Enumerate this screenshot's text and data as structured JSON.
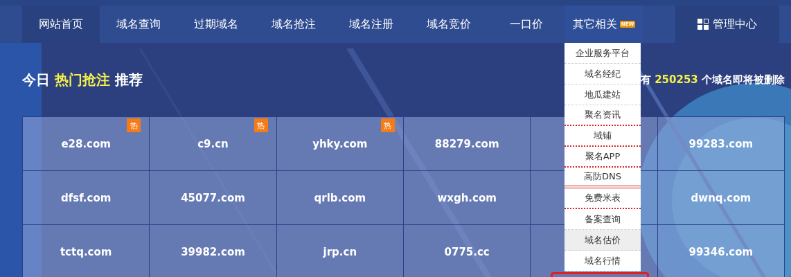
{
  "nav": {
    "items": [
      {
        "label": "网站首页",
        "selected": true
      },
      {
        "label": "域名查询",
        "selected": false
      },
      {
        "label": "过期域名",
        "selected": false
      },
      {
        "label": "域名抢注",
        "selected": false
      },
      {
        "label": "域名注册",
        "selected": false
      },
      {
        "label": "域名竞价",
        "selected": false
      },
      {
        "label": "一口价",
        "selected": false
      },
      {
        "label": "其它相关",
        "selected": false,
        "badge": "NEW",
        "expanded": true
      }
    ],
    "admin": "管理中心"
  },
  "heading": [
    {
      "text": "今日 ",
      "highlight": false
    },
    {
      "text": "热门抢注",
      "highlight": true
    },
    {
      "text": " 推荐",
      "highlight": false
    }
  ],
  "notice": [
    {
      "text": "有 ",
      "highlight": false
    },
    {
      "text": "250253",
      "highlight": true
    },
    {
      "text": " 个域名即将被删除",
      "highlight": false
    }
  ],
  "grid": {
    "rows": [
      [
        {
          "domain": "e28.com",
          "hot": "热"
        },
        {
          "domain": "c9.cn",
          "hot": "热"
        },
        {
          "domain": "yhky.com",
          "hot": "热"
        },
        {
          "domain": "88279.com"
        },
        {},
        {
          "domain": "99283.com"
        }
      ],
      [
        {
          "domain": "dfsf.com"
        },
        {
          "domain": "45077.com"
        },
        {
          "domain": "qrlb.com"
        },
        {
          "domain": "wxgh.com"
        },
        {},
        {
          "domain": "dwnq.com"
        }
      ],
      [
        {
          "domain": "tctq.com"
        },
        {
          "domain": "39982.com"
        },
        {
          "domain": "jrp.cn"
        },
        {
          "domain": "0775.cc"
        },
        {},
        {
          "domain": "99346.com"
        }
      ]
    ]
  },
  "dropdown": {
    "items": [
      {
        "label": "企业服务平台",
        "kind": "dashed",
        "selected": false
      },
      {
        "label": "域名经纪",
        "kind": "dashed",
        "selected": false
      },
      {
        "label": "地瓜建站",
        "kind": "dashed",
        "selected": false
      },
      {
        "label": "聚名资讯",
        "kind": "dotted",
        "selected": false
      },
      {
        "label": "域铺",
        "kind": "dotted",
        "selected": false
      },
      {
        "label": "聚名APP",
        "kind": "dotted",
        "selected": false
      },
      {
        "label": "高防DNS",
        "kind": "double",
        "selected": false
      },
      {
        "label": "免费米表",
        "kind": "dotted",
        "selected": false
      },
      {
        "label": "备案查询",
        "kind": "dashed",
        "selected": false
      },
      {
        "label": "域名估价",
        "kind": "dashed",
        "selected": true
      },
      {
        "label": "域名行情",
        "kind": "dashed",
        "selected": false
      }
    ]
  }
}
